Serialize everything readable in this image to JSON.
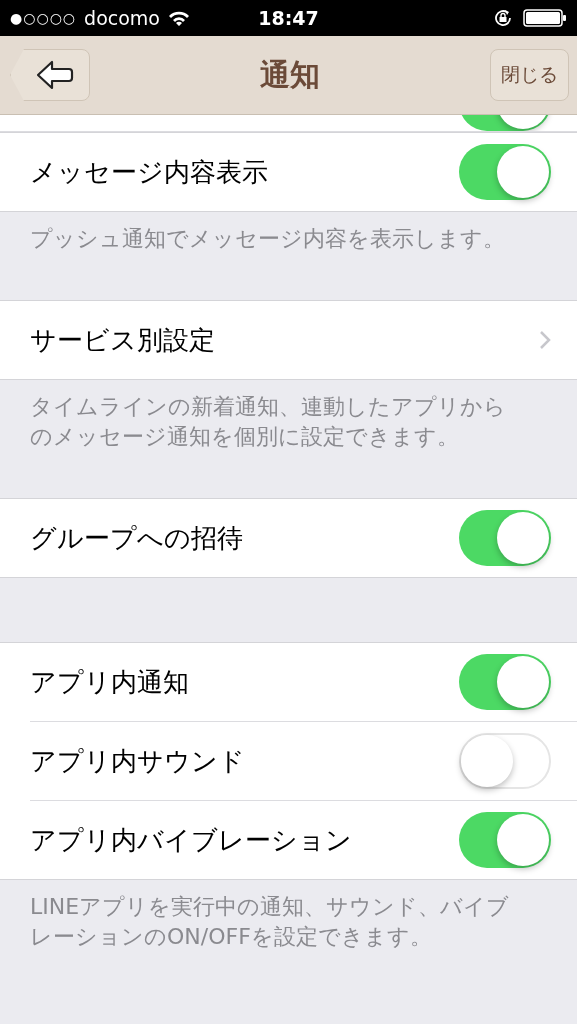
{
  "status_bar": {
    "signal_dots": "●○○○○",
    "carrier": "docomo",
    "time": "18:47"
  },
  "nav": {
    "title": "通知",
    "close": "閉じる"
  },
  "cut_row": {
    "on": true
  },
  "sections": [
    {
      "rows": [
        {
          "kind": "toggle",
          "label": "メッセージ内容表示",
          "on": true
        }
      ],
      "footer": "プッシュ通知でメッセージ内容を表示します。"
    },
    {
      "rows": [
        {
          "kind": "link",
          "label": "サービス別設定"
        }
      ],
      "footer": "タイムラインの新着通知、連動したアプリからのメッセージ通知を個別に設定できます。"
    },
    {
      "rows": [
        {
          "kind": "toggle",
          "label": "グループへの招待",
          "on": true
        }
      ]
    },
    {
      "rows": [
        {
          "kind": "toggle",
          "label": "アプリ内通知",
          "on": true
        },
        {
          "kind": "toggle",
          "label": "アプリ内サウンド",
          "on": false
        },
        {
          "kind": "toggle",
          "label": "アプリ内バイブレーション",
          "on": true
        }
      ],
      "footer": "LINEアプリを実行中の通知、サウンド、バイブレーションのON/OFFを設定できます。"
    }
  ]
}
